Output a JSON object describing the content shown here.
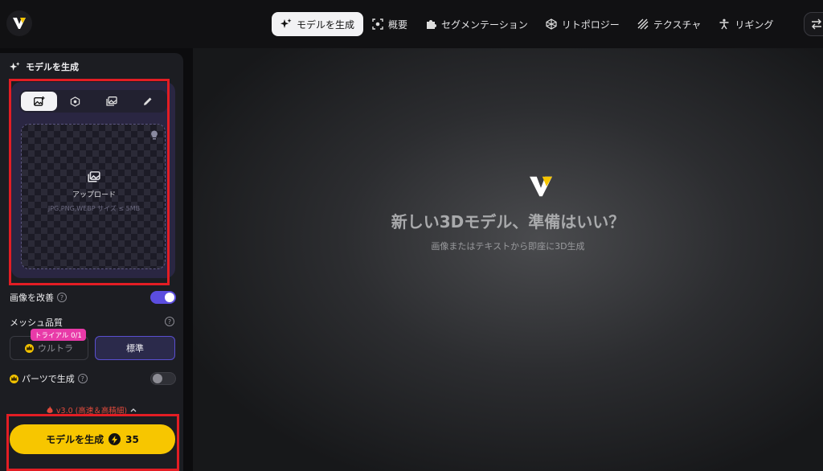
{
  "nav": {
    "items": [
      {
        "label": "モデルを生成",
        "icon": "sparkle-icon",
        "active": true
      },
      {
        "label": "概要",
        "icon": "focus-icon",
        "active": false
      },
      {
        "label": "セグメンテーション",
        "icon": "puzzle-icon",
        "active": false
      },
      {
        "label": "リトポロジー",
        "icon": "mesh-icon",
        "active": false
      },
      {
        "label": "テクスチャ",
        "icon": "texture-icon",
        "active": false
      },
      {
        "label": "リギング",
        "icon": "figure-icon",
        "active": false
      }
    ]
  },
  "panel": {
    "title": "モデルを生成",
    "upload": {
      "label": "アップロード",
      "hint": "JPG,PNG,WEBP サイズ ≤ 5MB"
    },
    "enhance_image": {
      "label": "画像を改善",
      "enabled": true
    },
    "mesh_quality": {
      "label": "メッシュ品質",
      "ultra_label": "ウルトラ",
      "trial_badge": "トライアル 0/1",
      "standard_label": "標準",
      "selected": "標準"
    },
    "parts": {
      "label": "パーツで生成",
      "enabled": false
    },
    "version": "v3.0 (高速＆高精細)",
    "generate": {
      "label": "モデルを生成",
      "cost": "35"
    }
  },
  "main": {
    "title": "新しい3Dモデル、準備はいい？",
    "subtitle": "画像またはテキストから即座に3D生成"
  },
  "colors": {
    "accent": "#f7c600",
    "toggle_on": "#5b4ddf",
    "badge": "#e83aa8",
    "highlight_box": "#e31d24"
  }
}
